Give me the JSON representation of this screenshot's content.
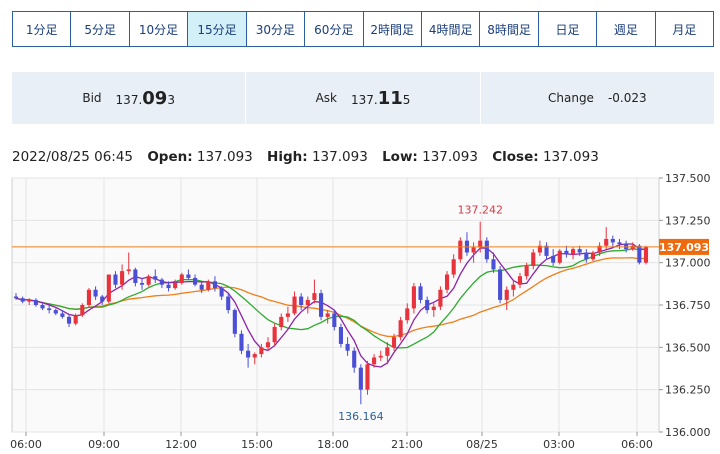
{
  "tabs": [
    {
      "label": "1分足",
      "active": false
    },
    {
      "label": "5分足",
      "active": false
    },
    {
      "label": "10分足",
      "active": false
    },
    {
      "label": "15分足",
      "active": true
    },
    {
      "label": "30分足",
      "active": false
    },
    {
      "label": "60分足",
      "active": false
    },
    {
      "label": "2時間足",
      "active": false
    },
    {
      "label": "4時間足",
      "active": false
    },
    {
      "label": "8時間足",
      "active": false
    },
    {
      "label": "日足",
      "active": false
    },
    {
      "label": "週足",
      "active": false
    },
    {
      "label": "月足",
      "active": false
    }
  ],
  "quote": {
    "bid_label": "Bid",
    "bid_prefix": "137.",
    "bid_big": "09",
    "bid_suffix": "3",
    "ask_label": "Ask",
    "ask_prefix": "137.",
    "ask_big": "11",
    "ask_suffix": "5",
    "change_label": "Change",
    "change_value": "-0.023"
  },
  "ohlc": {
    "datetime": "2022/08/25 06:45",
    "open_label": "Open:",
    "open": "137.093",
    "high_label": "High:",
    "high": "137.093",
    "low_label": "Low:",
    "low": "137.093",
    "close_label": "Close:",
    "close": "137.093"
  },
  "colors": {
    "up": "#e8323c",
    "down": "#4a4fd6",
    "ma_short": "#8e24aa",
    "ma_mid": "#2eaa2e",
    "ma_long": "#ef7f1a",
    "price_line": "#ef7f1a",
    "price_tag": "#ef6a0c"
  },
  "chart_data": {
    "type": "candlestick",
    "x_tick_labels": [
      "06:00",
      "09:00",
      "12:00",
      "15:00",
      "18:00",
      "21:00",
      "08/25",
      "03:00",
      "06:00"
    ],
    "y_tick_labels": [
      "137.500",
      "137.250",
      "137.000",
      "136.750",
      "136.500",
      "136.250",
      "136.000"
    ],
    "ylim": [
      136.0,
      137.5
    ],
    "current_price": "137.093",
    "annotations": [
      {
        "text": "137.242",
        "kind": "high",
        "value": 137.242
      },
      {
        "text": "136.164",
        "kind": "low",
        "value": 136.164
      }
    ],
    "candles_ohlc": [
      [
        136.8,
        136.82,
        136.78,
        136.79
      ],
      [
        136.79,
        136.8,
        136.76,
        136.77
      ],
      [
        136.77,
        136.79,
        136.75,
        136.78
      ],
      [
        136.78,
        136.79,
        136.74,
        136.75
      ],
      [
        136.75,
        136.76,
        136.72,
        136.73
      ],
      [
        136.73,
        136.75,
        136.7,
        136.72
      ],
      [
        136.72,
        136.73,
        136.69,
        136.7
      ],
      [
        136.7,
        136.72,
        136.67,
        136.68
      ],
      [
        136.68,
        136.69,
        136.62,
        136.64
      ],
      [
        136.64,
        136.7,
        136.63,
        136.69
      ],
      [
        136.69,
        136.76,
        136.68,
        136.75
      ],
      [
        136.75,
        136.85,
        136.74,
        136.84
      ],
      [
        136.84,
        136.86,
        136.78,
        136.8
      ],
      [
        136.8,
        136.81,
        136.75,
        136.77
      ],
      [
        136.77,
        136.9,
        136.76,
        136.93
      ],
      [
        136.93,
        136.95,
        136.85,
        136.87
      ],
      [
        136.87,
        136.99,
        136.84,
        136.95
      ],
      [
        136.95,
        137.06,
        136.93,
        136.96
      ],
      [
        136.96,
        136.97,
        136.86,
        136.88
      ],
      [
        136.88,
        136.91,
        136.84,
        136.87
      ],
      [
        136.87,
        136.93,
        136.86,
        136.92
      ],
      [
        136.92,
        136.96,
        136.88,
        136.9
      ],
      [
        136.9,
        136.91,
        136.85,
        136.87
      ],
      [
        136.87,
        136.89,
        136.83,
        136.85
      ],
      [
        136.85,
        136.9,
        136.84,
        136.88
      ],
      [
        136.88,
        136.94,
        136.87,
        136.93
      ],
      [
        136.93,
        136.96,
        136.9,
        136.91
      ],
      [
        136.91,
        136.93,
        136.86,
        136.87
      ],
      [
        136.87,
        136.89,
        136.82,
        136.84
      ],
      [
        136.84,
        136.9,
        136.83,
        136.89
      ],
      [
        136.89,
        136.92,
        136.83,
        136.85
      ],
      [
        136.85,
        136.86,
        136.78,
        136.8
      ],
      [
        136.8,
        136.82,
        136.7,
        136.72
      ],
      [
        136.72,
        136.73,
        136.56,
        136.58
      ],
      [
        136.58,
        136.6,
        136.46,
        136.48
      ],
      [
        136.48,
        136.52,
        136.38,
        136.44
      ],
      [
        136.44,
        136.47,
        136.4,
        136.46
      ],
      [
        136.46,
        136.52,
        136.44,
        136.5
      ],
      [
        136.5,
        136.56,
        136.48,
        136.53
      ],
      [
        136.53,
        136.64,
        136.51,
        136.62
      ],
      [
        136.62,
        136.7,
        136.6,
        136.68
      ],
      [
        136.68,
        136.74,
        136.65,
        136.7
      ],
      [
        136.7,
        136.83,
        136.69,
        136.8
      ],
      [
        136.8,
        136.82,
        136.72,
        136.75
      ],
      [
        136.75,
        136.8,
        136.7,
        136.78
      ],
      [
        136.78,
        136.9,
        136.76,
        136.82
      ],
      [
        136.82,
        136.84,
        136.66,
        136.68
      ],
      [
        136.68,
        136.72,
        136.64,
        136.7
      ],
      [
        136.7,
        136.72,
        136.6,
        136.62
      ],
      [
        136.62,
        136.64,
        136.5,
        136.52
      ],
      [
        136.52,
        136.56,
        136.45,
        136.48
      ],
      [
        136.48,
        136.5,
        136.35,
        136.38
      ],
      [
        136.38,
        136.4,
        136.164,
        136.25
      ],
      [
        136.25,
        136.42,
        136.22,
        136.4
      ],
      [
        136.4,
        136.46,
        136.38,
        136.44
      ],
      [
        136.44,
        136.48,
        136.42,
        136.45
      ],
      [
        136.45,
        136.53,
        136.4,
        136.5
      ],
      [
        136.5,
        136.58,
        136.48,
        136.56
      ],
      [
        136.56,
        136.68,
        136.54,
        136.66
      ],
      [
        136.66,
        136.76,
        136.64,
        136.73
      ],
      [
        136.73,
        136.88,
        136.7,
        136.86
      ],
      [
        136.86,
        136.88,
        136.76,
        136.78
      ],
      [
        136.78,
        136.8,
        136.7,
        136.72
      ],
      [
        136.72,
        136.76,
        136.68,
        136.74
      ],
      [
        136.74,
        136.86,
        136.72,
        136.84
      ],
      [
        136.84,
        136.95,
        136.82,
        136.93
      ],
      [
        136.93,
        137.05,
        136.91,
        137.02
      ],
      [
        137.02,
        137.15,
        137.0,
        137.13
      ],
      [
        137.13,
        137.18,
        137.04,
        137.06
      ],
      [
        137.06,
        137.12,
        137.0,
        137.09
      ],
      [
        137.09,
        137.242,
        137.06,
        137.13
      ],
      [
        137.13,
        137.15,
        137.0,
        137.02
      ],
      [
        137.02,
        137.06,
        136.94,
        136.96
      ],
      [
        136.96,
        136.98,
        136.76,
        136.78
      ],
      [
        136.78,
        136.86,
        136.72,
        136.84
      ],
      [
        136.84,
        136.9,
        136.8,
        136.87
      ],
      [
        136.87,
        136.94,
        136.85,
        136.92
      ],
      [
        136.92,
        137.0,
        136.9,
        136.98
      ],
      [
        136.98,
        137.08,
        136.96,
        137.06
      ],
      [
        137.06,
        137.13,
        137.04,
        137.1
      ],
      [
        137.1,
        137.12,
        137.02,
        137.04
      ],
      [
        137.04,
        137.08,
        136.98,
        137.0
      ],
      [
        137.0,
        137.08,
        136.99,
        137.07
      ],
      [
        137.07,
        137.1,
        137.03,
        137.05
      ],
      [
        137.05,
        137.09,
        137.02,
        137.08
      ],
      [
        137.08,
        137.1,
        137.04,
        137.06
      ],
      [
        137.06,
        137.08,
        137.0,
        137.02
      ],
      [
        137.02,
        137.07,
        137.01,
        137.06
      ],
      [
        137.06,
        137.12,
        137.04,
        137.1
      ],
      [
        137.1,
        137.21,
        137.08,
        137.14
      ],
      [
        137.14,
        137.16,
        137.09,
        137.12
      ],
      [
        137.12,
        137.14,
        137.08,
        137.11
      ],
      [
        137.11,
        137.13,
        137.06,
        137.08
      ],
      [
        137.08,
        137.12,
        137.07,
        137.1
      ],
      [
        137.1,
        137.11,
        136.99,
        137.0
      ],
      [
        137.0,
        137.1,
        136.99,
        137.093
      ]
    ]
  }
}
